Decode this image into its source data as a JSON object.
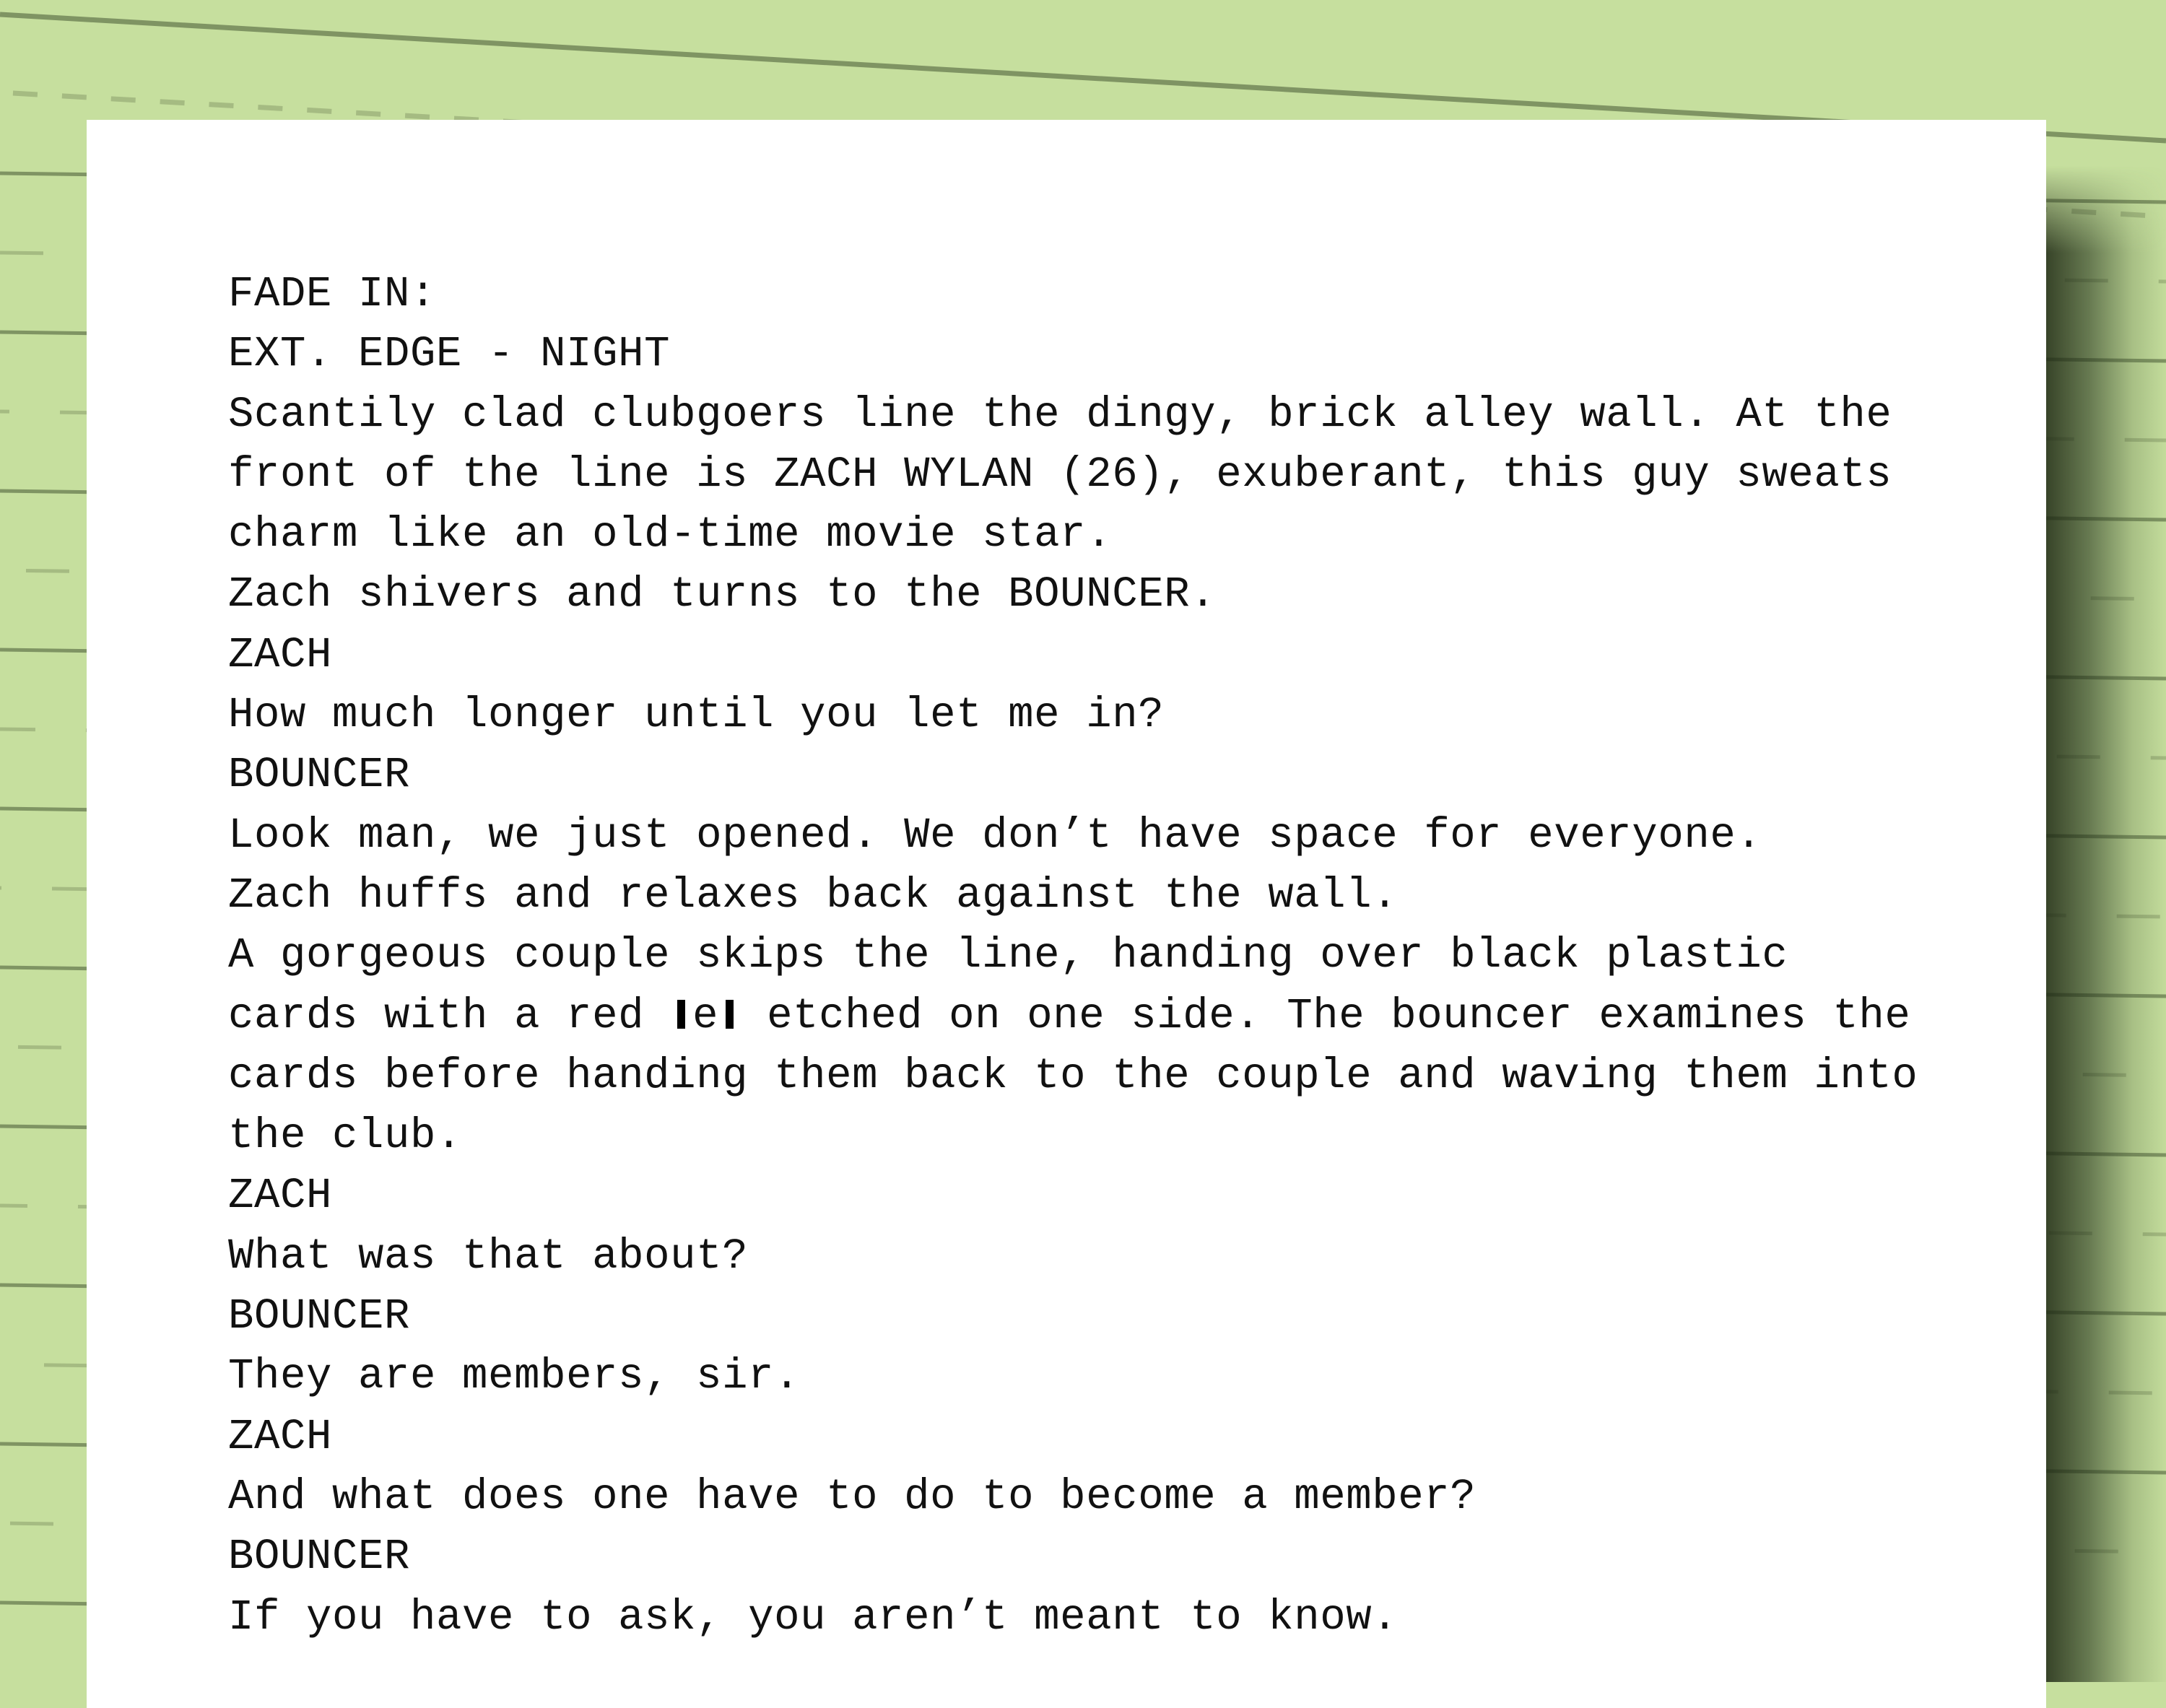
{
  "document": {
    "type": "screenplay",
    "colors": {
      "background": "#c6df9e",
      "rule_line": "#7f9463",
      "dash_line": "#a5bb82",
      "paper": "#ffffff",
      "text": "#111111"
    },
    "lines": [
      {
        "kind": "transition",
        "text": "FADE IN:"
      },
      {
        "kind": "scene-heading",
        "text": "EXT. EDGE - NIGHT"
      },
      {
        "kind": "action",
        "text": "Scantily clad clubgoers line the dingy, brick alley wall. At the"
      },
      {
        "kind": "action",
        "text": "front of the line is ZACH WYLAN (26), exuberant, this guy sweats"
      },
      {
        "kind": "action",
        "text": "charm like an old-time movie star."
      },
      {
        "kind": "action",
        "text": "Zach shivers and turns to the BOUNCER."
      },
      {
        "kind": "character",
        "text": "ZACH"
      },
      {
        "kind": "dialogue",
        "text": "How much longer until you let me in?"
      },
      {
        "kind": "character",
        "text": "BOUNCER"
      },
      {
        "kind": "dialogue",
        "text": "Look man, we just opened. We don’t have space for everyone."
      },
      {
        "kind": "action",
        "text": "Zach huffs and relaxes back against the wall."
      },
      {
        "kind": "action",
        "text": "A gorgeous couple skips the line, handing over black plastic"
      },
      {
        "kind": "action-mark",
        "before": "cards with a red ",
        "mark": "e",
        "after": " etched on one side. The bouncer examines the"
      },
      {
        "kind": "action",
        "text": "cards before handing them back to the couple and waving them into"
      },
      {
        "kind": "action",
        "text": "the club."
      },
      {
        "kind": "character",
        "text": "ZACH"
      },
      {
        "kind": "dialogue",
        "text": "What was that about?"
      },
      {
        "kind": "character",
        "text": "BOUNCER"
      },
      {
        "kind": "dialogue",
        "text": "They are members, sir."
      },
      {
        "kind": "character",
        "text": "ZACH"
      },
      {
        "kind": "dialogue",
        "text": "And what does one have to do to become a member?"
      },
      {
        "kind": "character",
        "text": "BOUNCER"
      },
      {
        "kind": "dialogue",
        "text": "If you have to ask, you aren’t meant to know."
      }
    ]
  }
}
